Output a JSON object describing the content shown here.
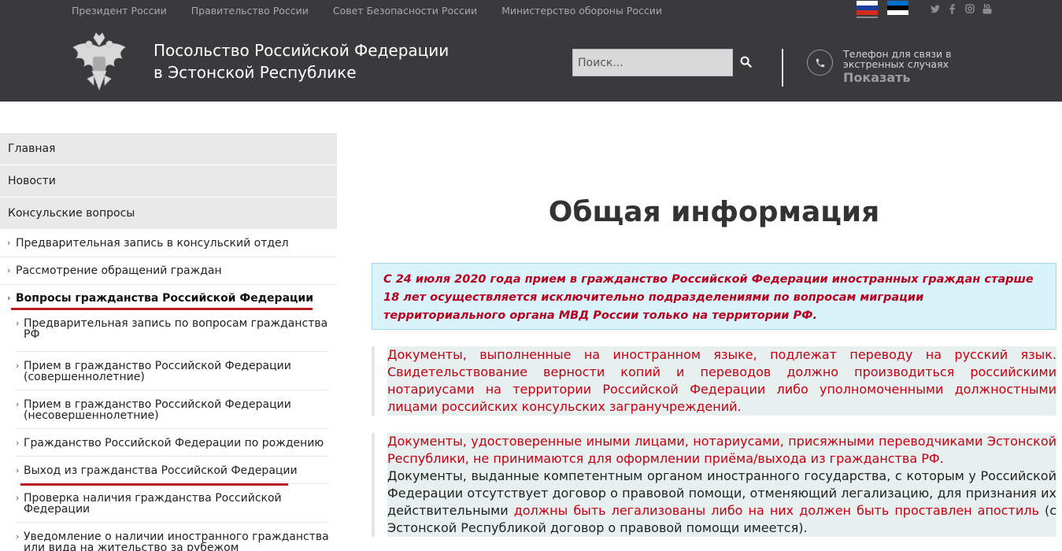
{
  "topbar": {
    "links": [
      "Президент России",
      "Правительство России",
      "Совет Безопасности России",
      "Министерство обороны России"
    ],
    "flags": [
      "russia-flag",
      "estonia-flag"
    ],
    "social_icons": [
      "twitter-icon",
      "facebook-icon",
      "instagram-icon",
      "youtube-icon"
    ]
  },
  "header": {
    "title_line1": "Посольство Российской Федерации",
    "title_line2": "в Эстонской Республике",
    "search_placeholder": "Поиск...",
    "phone_label": "Телефон для связи в экстренных случаях",
    "phone_show": "Показать"
  },
  "sidebar": {
    "main_items": [
      "Главная",
      "Новости",
      "Консульские вопросы"
    ],
    "sub_items": [
      "Предварительная запись в консульский отдел",
      "Рассмотрение обращений граждан",
      "Вопросы гражданства Российской Федерации"
    ],
    "sub3_items": [
      "Предварительная запись по вопросам гражданства РФ",
      "Прием в гражданство Российской Федерации (совершеннолетние)",
      "Прием в гражданство Российской Федерации (несовершеннолетние)",
      "Гражданство Российской Федерации по рождению",
      "Выход из гражданства Российской Федерации",
      "Проверка наличия гражданства Российской Федерации",
      "Уведомление о наличии иностранного гражданства или вида на жительство за рубежом"
    ],
    "chevron": "›"
  },
  "main": {
    "title": "Общая информация",
    "notice": "С 24 июля 2020 года прием в гражданство Российской Федерации иностранных граждан старше 18 лет осуществляется исключительно подразделениями по вопросам миграции территориального органа МВД России только на территории РФ.",
    "quote1": "Документы, выполненные на иностранном языке, подлежат переводу на русский язык. Свидетельствование верности копий и переводов должно производиться российскими нотариусами на территории Российской Федерации либо уполномоченными должностными лицами российских консульских загранучреждений.",
    "quote2_red": "Документы, удостоверенные иными лицами, нотариусами, присяжными переводчиками Эстонской Республики, не принимаются для оформлении приёма/выхода из гражданства РФ.",
    "quote2_black1": "Документы, выданные компетентным органом иностранного государства, с которым у Российской Федерации отсутствует договор о правовой помощи, отменяющий легализацию, для признания их действительными",
    "quote2_red2": "должны быть легализованы либо на них должен быть проставлен апостиль",
    "quote2_black2": "(с Эстонской Республикой договор о правовой помощи имеется)."
  },
  "colors": {
    "header_bg": "#3a3a3c",
    "accent_red": "#c60012",
    "notice_bg": "#d8f3f9",
    "sidebar_bg": "#e9e9e9"
  }
}
